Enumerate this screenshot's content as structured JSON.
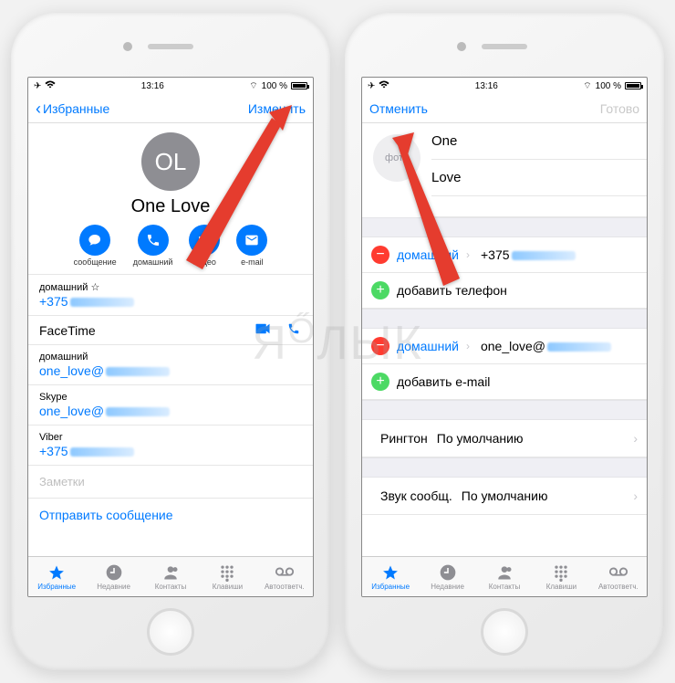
{
  "status": {
    "time": "13:16",
    "battery": "100 %"
  },
  "left": {
    "nav_back": "Избранные",
    "nav_edit": "Изменить",
    "avatar_initials": "OL",
    "name": "One Love",
    "company_icon": "",
    "actions": {
      "message": "сообщение",
      "call": "домашний",
      "video": "видео",
      "mail": "e-mail"
    },
    "home_phone_label": "домашний ☆",
    "home_phone_value": "+375",
    "facetime_label": "FaceTime",
    "email_label": "домашний",
    "email_value": "one_love@",
    "skype_label": "Skype",
    "skype_value": "one_love@",
    "viber_label": "Viber",
    "viber_value": "+375",
    "notes": "Заметки",
    "send_message": "Отправить сообщение"
  },
  "right": {
    "nav_cancel": "Отменить",
    "nav_done": "Готово",
    "photo_label": "фото",
    "first_name": "One",
    "last_name": "Love",
    "company_icon": "",
    "phone_label": "домашний",
    "phone_value": "+375",
    "add_phone": "добавить телефон",
    "email_label": "домашний",
    "email_value": "one_love@",
    "add_email": "добавить e-mail",
    "ringtone_label": "Рингтон",
    "ringtone_value": "По умолчанию",
    "text_tone_label": "Звук сообщ.",
    "text_tone_value": "По умолчанию"
  },
  "tabs": {
    "favorites": "Избранные",
    "recents": "Недавние",
    "contacts": "Контакты",
    "keypad": "Клавиши",
    "voicemail": "Автоответч."
  },
  "watermark": "ЯБЛЫК"
}
